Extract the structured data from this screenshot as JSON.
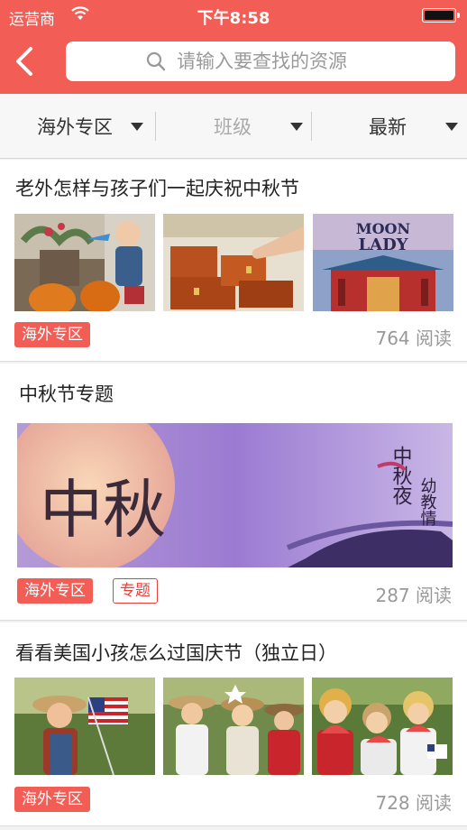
{
  "status_bar": {
    "carrier": "运营商",
    "time": "下午8:58"
  },
  "header": {
    "back_icon": "chevron-left-icon",
    "search_placeholder": "请输入要查找的资源",
    "search_icon": "search-icon"
  },
  "filters": [
    {
      "label": "海外专区",
      "active": true
    },
    {
      "label": "班级",
      "active": false
    },
    {
      "label": "最新",
      "active": true
    }
  ],
  "articles": [
    {
      "title": "老外怎样与孩子们一起庆祝中秋节",
      "images": [
        "child-with-pumpkins-photo",
        "wooden-boxes-photo",
        "moon-lady-book-cover"
      ],
      "tags": [
        {
          "label": "海外专区",
          "style": "filled"
        }
      ],
      "read_count": "764 阅读"
    },
    {
      "title": "中秋节专题",
      "images": [
        "mid-autumn-banner"
      ],
      "banner_text": {
        "main": "中秋",
        "side": "中秋夜",
        "side2": "幼教情"
      },
      "tags": [
        {
          "label": "海外专区",
          "style": "filled"
        },
        {
          "label": "专题",
          "style": "outline"
        }
      ],
      "read_count": "287 阅读"
    },
    {
      "title": "看看美国小孩怎么过国庆节（独立日）",
      "images": [
        "boy-with-flag-photo",
        "kids-cowboy-hats-photo",
        "kids-eating-watermelon-photo"
      ],
      "tags": [
        {
          "label": "海外专区",
          "style": "filled"
        }
      ],
      "read_count": "728 阅读"
    }
  ],
  "colors": {
    "accent": "#f25d55",
    "tag_outline": "#e8403a"
  }
}
